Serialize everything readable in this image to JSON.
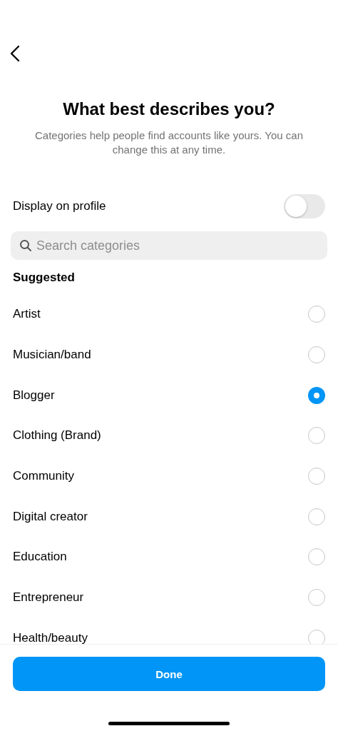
{
  "title": "What best describes you?",
  "subtitle": "Categories help people find accounts like yours. You can change this at any time.",
  "display_on_profile": {
    "label": "Display on profile",
    "on": false
  },
  "search": {
    "placeholder": "Search categories"
  },
  "section_title": "Suggested",
  "categories": [
    {
      "label": "Artist",
      "selected": false
    },
    {
      "label": "Musician/band",
      "selected": false
    },
    {
      "label": "Blogger",
      "selected": true
    },
    {
      "label": "Clothing (Brand)",
      "selected": false
    },
    {
      "label": "Community",
      "selected": false
    },
    {
      "label": "Digital creator",
      "selected": false
    },
    {
      "label": "Education",
      "selected": false
    },
    {
      "label": "Entrepreneur",
      "selected": false
    },
    {
      "label": "Health/beauty",
      "selected": false
    }
  ],
  "done_button": "Done"
}
